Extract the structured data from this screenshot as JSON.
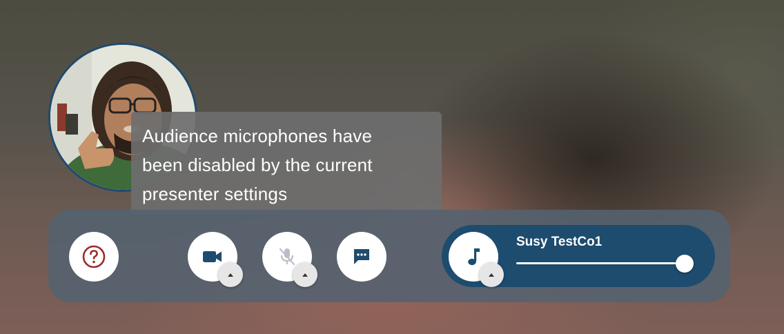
{
  "tooltip": {
    "lines": [
      "Audience microphones have",
      "been disabled by the current",
      "presenter settings"
    ]
  },
  "controls": {
    "help_icon": "question-circle-icon",
    "camera_icon": "video-camera-icon",
    "mic_icon": "microphone-off-icon",
    "chat_icon": "chat-bubble-icon",
    "music_icon": "music-note-icon"
  },
  "music": {
    "track_name": "Susy TestCo1",
    "volume": 1.0
  },
  "colors": {
    "accent": "#1d4c6e",
    "help_icon": "#9b2c2c",
    "bar": "#546270"
  }
}
